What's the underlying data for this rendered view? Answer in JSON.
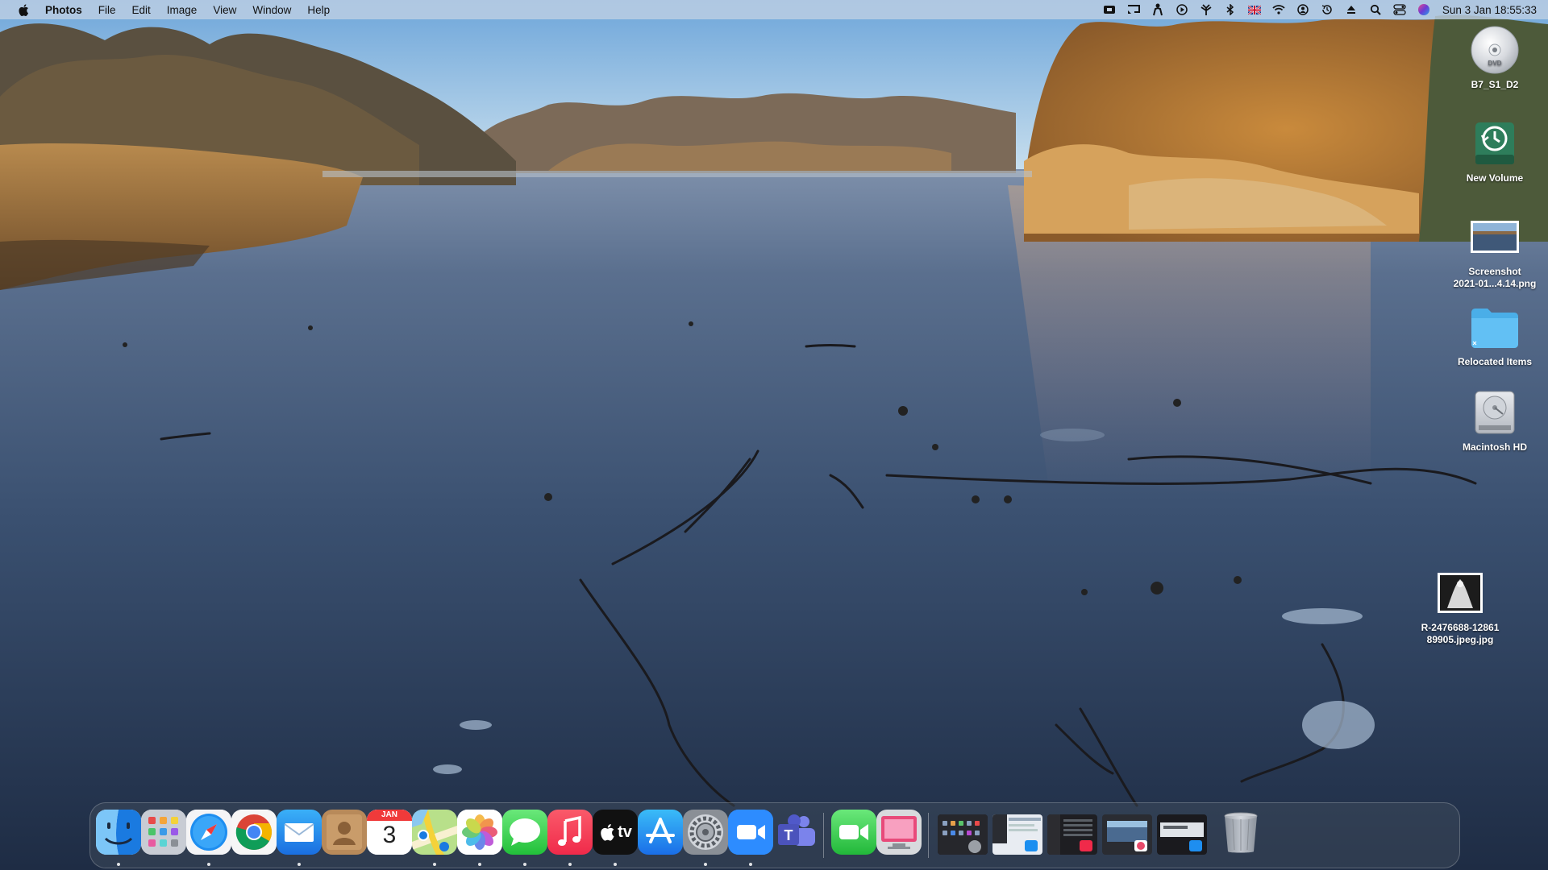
{
  "menubar": {
    "app_name": "Photos",
    "menus": [
      "File",
      "Edit",
      "Image",
      "View",
      "Window",
      "Help"
    ],
    "status_icons": [
      "video-icon",
      "cast-icon",
      "accessibility-icon",
      "play-icon",
      "antenna-icon",
      "bluetooth-icon",
      "uk-flag-icon",
      "wifi-icon",
      "user-icon",
      "time-machine-icon",
      "eject-icon",
      "search-icon",
      "control-center-icon",
      "siri-icon"
    ],
    "clock": "Sun 3 Jan  18:55:33"
  },
  "desktop_icons": [
    {
      "name": "B7_S1_D2",
      "icon": "dvd-icon"
    },
    {
      "name": "New Volume",
      "icon": "time-machine-drive-icon"
    },
    {
      "name": "Screenshot\n2021-01...4.14.png",
      "icon": "screenshot-thumbnail-icon"
    },
    {
      "name": "Relocated Items",
      "icon": "folder-icon"
    },
    {
      "name": "Macintosh HD",
      "icon": "hard-drive-icon"
    },
    {
      "name": "R-2476688-12861\n89905.jpeg.jpg",
      "icon": "image-file-icon"
    }
  ],
  "calendar_icon": {
    "month": "JAN",
    "day": "3"
  },
  "dock": {
    "apps": [
      {
        "name": "Finder",
        "icon": "finder-icon",
        "running": true
      },
      {
        "name": "Launchpad",
        "icon": "launchpad-icon",
        "running": false
      },
      {
        "name": "Safari",
        "icon": "safari-icon",
        "running": true
      },
      {
        "name": "Google Chrome",
        "icon": "chrome-icon",
        "running": false
      },
      {
        "name": "Mail",
        "icon": "mail-icon",
        "running": true
      },
      {
        "name": "Contacts",
        "icon": "contacts-icon",
        "running": false
      },
      {
        "name": "Calendar",
        "icon": "calendar-icon",
        "running": false
      },
      {
        "name": "Maps",
        "icon": "maps-icon",
        "running": true
      },
      {
        "name": "Photos",
        "icon": "photos-icon",
        "running": true
      },
      {
        "name": "Messages",
        "icon": "messages-icon",
        "running": true
      },
      {
        "name": "Music",
        "icon": "music-icon",
        "running": true
      },
      {
        "name": "TV",
        "icon": "tv-icon",
        "running": true
      },
      {
        "name": "App Store",
        "icon": "app-store-icon",
        "running": false
      },
      {
        "name": "System Preferences",
        "icon": "system-preferences-icon",
        "running": true
      },
      {
        "name": "Zoom",
        "icon": "zoom-icon",
        "running": true
      },
      {
        "name": "Microsoft Teams",
        "icon": "teams-icon",
        "running": false
      },
      {
        "name": "FaceTime",
        "icon": "facetime-icon",
        "running": false
      },
      {
        "name": "Photo Booth",
        "icon": "photo-booth-icon",
        "running": false
      }
    ],
    "minimized_windows": [
      "system-preferences-window-thumbnail",
      "mail-window-thumbnail",
      "music-window-thumbnail",
      "photos-window-thumbnail",
      "safari-window-thumbnail"
    ],
    "trash": {
      "name": "Trash",
      "icon": "trash-icon"
    },
    "tv_label": "tv"
  }
}
